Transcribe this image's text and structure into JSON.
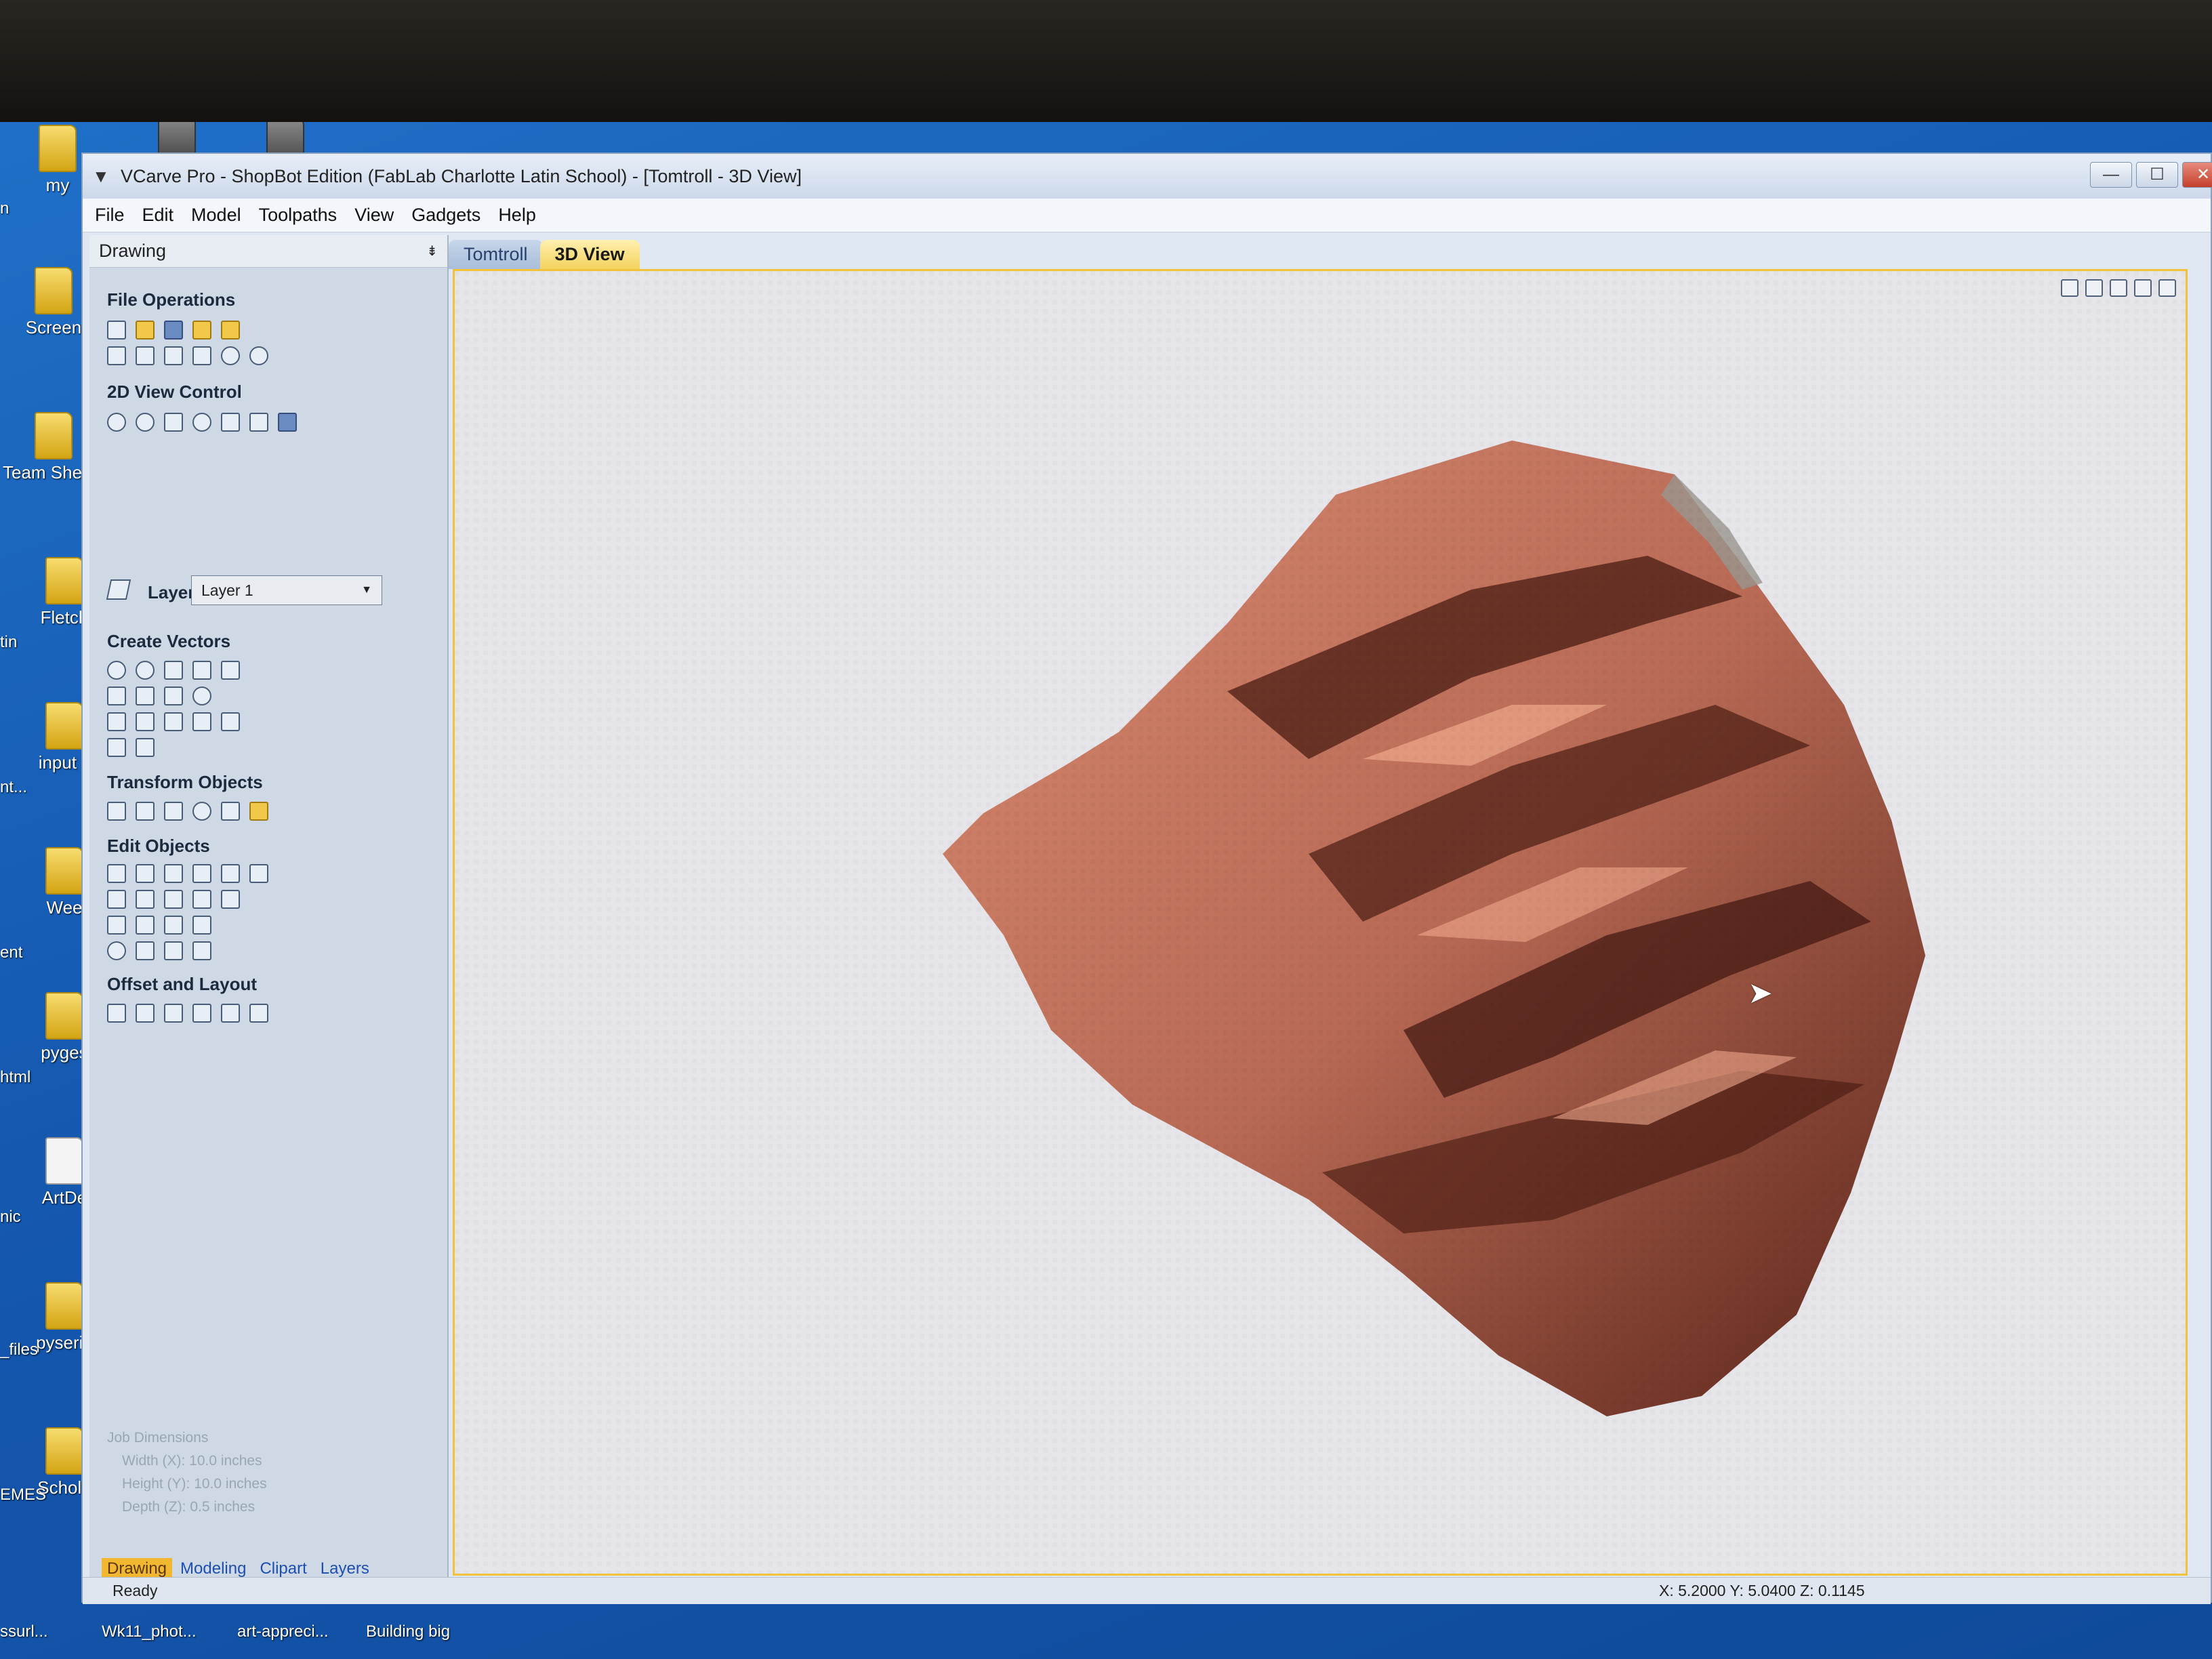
{
  "window": {
    "title": "VCarve Pro - ShopBot Edition (FabLab Charlotte Latin School) - [Tomtroll - 3D View]",
    "controls": [
      "—",
      "☐",
      "✕"
    ]
  },
  "menu": [
    "File",
    "Edit",
    "Model",
    "Toolpaths",
    "View",
    "Gadgets",
    "Help"
  ],
  "panel": {
    "header": "Drawing",
    "pin": "⇟",
    "sections": {
      "file_operations": "File Operations",
      "view_control": "2D View Control",
      "create_vectors": "Create Vectors",
      "transform_objects": "Transform Objects",
      "edit_objects": "Edit Objects",
      "offset_layout": "Offset and Layout"
    },
    "layer_label": "Layer",
    "layer_value": "Layer 1",
    "job_dimensions": {
      "title": "Job Dimensions",
      "width": "Width  (X): 10.0 inches",
      "height": "Height (Y): 10.0 inches",
      "depth": "Depth  (Z): 0.5 inches"
    },
    "tabs": [
      "Drawing",
      "Modeling",
      "Clipart",
      "Layers"
    ]
  },
  "doc_tabs": [
    "Tomtroll",
    "3D View"
  ],
  "status": {
    "ready": "Ready",
    "coords": "X:  5.2000 Y:  5.0400 Z:  0.1145"
  },
  "desktop": {
    "icons": [
      "my",
      "Screen",
      "Team Sheets",
      "Fletch",
      "input c",
      "Wee",
      "pyges",
      "ArtDe",
      "pyseria",
      "Schola"
    ],
    "left_labels": [
      "n",
      "tin",
      "nt...",
      "ent",
      "html",
      "nic",
      "_files",
      "EMES"
    ],
    "bottom_labels": [
      "ssurl...",
      "Wk11_phot...",
      "art-appreci...",
      "Building big"
    ]
  }
}
